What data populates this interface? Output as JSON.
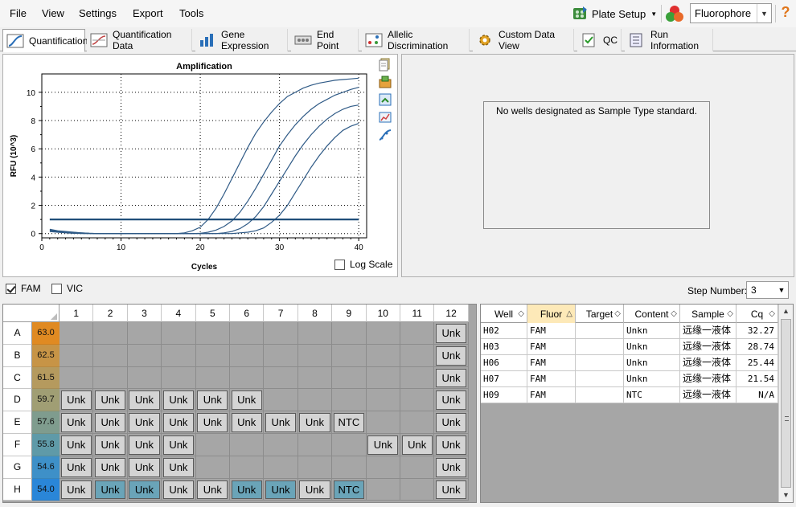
{
  "menu": {
    "file": "File",
    "view": "View",
    "settings": "Settings",
    "export": "Export",
    "tools": "Tools"
  },
  "toolbar": {
    "plate_setup": "Plate Setup",
    "fluorophore": "Fluorophore",
    "help": "?"
  },
  "tabs": [
    {
      "label": "Quantification",
      "icon": "amplification-chart-icon",
      "active": true
    },
    {
      "label": "Quantification Data",
      "icon": "data-chart-icon"
    },
    {
      "label": "Gene Expression",
      "icon": "bar-chart-icon"
    },
    {
      "label": "End Point",
      "icon": "endpoint-icon"
    },
    {
      "label": "Allelic Discrimination",
      "icon": "scatter-icon"
    },
    {
      "label": "Custom Data View",
      "icon": "gear-icon"
    },
    {
      "label": "QC",
      "icon": "qc-check-icon"
    },
    {
      "label": "Run Information",
      "icon": "run-info-icon"
    }
  ],
  "chart_data": {
    "type": "line",
    "title": "Amplification",
    "xlabel": "Cycles",
    "ylabel": "RFU (10^3)",
    "xlim": [
      0,
      41
    ],
    "ylim": [
      -0.3,
      11.3
    ],
    "x_ticks": [
      0,
      10,
      20,
      30,
      40
    ],
    "y_ticks": [
      0,
      2,
      4,
      6,
      8,
      10
    ],
    "grid": true,
    "threshold": 1.0,
    "x": [
      1,
      2,
      3,
      4,
      5,
      6,
      7,
      8,
      9,
      10,
      11,
      12,
      13,
      14,
      15,
      16,
      17,
      18,
      19,
      20,
      21,
      22,
      23,
      24,
      25,
      26,
      27,
      28,
      29,
      30,
      31,
      32,
      33,
      34,
      35,
      36,
      37,
      38,
      39,
      40
    ],
    "series": [
      {
        "well": "H07",
        "values": [
          0.3,
          0.2,
          0.15,
          0.1,
          0.05,
          0.02,
          0,
          0,
          0,
          0,
          0,
          0,
          0,
          0,
          0,
          0,
          0,
          0.05,
          0.2,
          0.45,
          1.0,
          1.8,
          2.8,
          3.9,
          5.0,
          6.1,
          7.1,
          7.9,
          8.6,
          9.2,
          9.7,
          10.0,
          10.3,
          10.5,
          10.65,
          10.75,
          10.85,
          10.9,
          10.95,
          11.0
        ]
      },
      {
        "well": "H06",
        "values": [
          0.25,
          0.18,
          0.12,
          0.08,
          0.05,
          0.02,
          0,
          0,
          0,
          0,
          0,
          0,
          0,
          0,
          0,
          0,
          0,
          0,
          0,
          0.02,
          0.1,
          0.25,
          0.5,
          0.9,
          1.5,
          2.3,
          3.2,
          4.2,
          5.2,
          6.2,
          7.0,
          7.7,
          8.3,
          8.8,
          9.2,
          9.5,
          9.8,
          10.0,
          10.2,
          10.35
        ]
      },
      {
        "well": "H03",
        "values": [
          0.2,
          0.15,
          0.1,
          0.05,
          0.02,
          0,
          0,
          0,
          0,
          0,
          0,
          0,
          0,
          0,
          0,
          0,
          0,
          0,
          0,
          0,
          0,
          0,
          0.05,
          0.15,
          0.35,
          0.7,
          1.2,
          1.9,
          2.8,
          3.7,
          4.6,
          5.5,
          6.3,
          7.0,
          7.6,
          8.1,
          8.5,
          8.8,
          9.0,
          9.1
        ]
      },
      {
        "well": "H02",
        "values": [
          0.15,
          0.1,
          0.05,
          0.02,
          0,
          0,
          0,
          0,
          0,
          0,
          0,
          0,
          0,
          0,
          0,
          0,
          0,
          0,
          0,
          0,
          0,
          0,
          0,
          0,
          0.05,
          0.1,
          0.2,
          0.4,
          0.8,
          1.3,
          2.0,
          2.9,
          3.8,
          4.7,
          5.5,
          6.2,
          6.8,
          7.3,
          7.6,
          7.8
        ]
      }
    ]
  },
  "log_scale_label": "Log Scale",
  "std_message": "No wells designated as Sample Type standard.",
  "filters": {
    "fam": "FAM",
    "vic": "VIC",
    "fam_checked": true,
    "vic_checked": false
  },
  "step": {
    "label": "Step Number:",
    "value": "3"
  },
  "plate": {
    "columns": [
      "1",
      "2",
      "3",
      "4",
      "5",
      "6",
      "7",
      "8",
      "9",
      "10",
      "11",
      "12"
    ],
    "rows": [
      {
        "label": "A",
        "temp": "63.0",
        "color": "#e08a22",
        "wells": [
          "",
          "",
          "",
          "",
          "",
          "",
          "",
          "",
          "",
          "",
          "",
          "Unk"
        ]
      },
      {
        "label": "B",
        "temp": "62.5",
        "color": "#c79446",
        "wells": [
          "",
          "",
          "",
          "",
          "",
          "",
          "",
          "",
          "",
          "",
          "",
          "Unk"
        ]
      },
      {
        "label": "C",
        "temp": "61.5",
        "color": "#b59a5e",
        "wells": [
          "",
          "",
          "",
          "",
          "",
          "",
          "",
          "",
          "",
          "",
          "",
          "Unk"
        ]
      },
      {
        "label": "D",
        "temp": "59.7",
        "color": "#a09e74",
        "wells": [
          "Unk",
          "Unk",
          "Unk",
          "Unk",
          "Unk",
          "Unk",
          "",
          "",
          "",
          "",
          "",
          "Unk"
        ]
      },
      {
        "label": "E",
        "temp": "57.6",
        "color": "#7f9c8e",
        "wells": [
          "Unk",
          "Unk",
          "Unk",
          "Unk",
          "Unk",
          "Unk",
          "Unk",
          "Unk",
          "NTC",
          "",
          "",
          "Unk"
        ]
      },
      {
        "label": "F",
        "temp": "55.8",
        "color": "#5f9aa8",
        "wells": [
          "Unk",
          "Unk",
          "Unk",
          "Unk",
          "",
          "",
          "",
          "",
          "",
          "Unk",
          "Unk",
          "Unk"
        ]
      },
      {
        "label": "G",
        "temp": "54.6",
        "color": "#3e90c8",
        "wells": [
          "Unk",
          "Unk",
          "Unk",
          "Unk",
          "",
          "",
          "",
          "",
          "",
          "",
          "",
          "Unk"
        ]
      },
      {
        "label": "H",
        "temp": "54.0",
        "color": "#2a86d8",
        "wells": [
          "Unk",
          "Unk",
          "Unk",
          "Unk",
          "Unk",
          "Unk",
          "Unk",
          "Unk",
          "NTC",
          "",
          "",
          "Unk"
        ],
        "selected": [
          1,
          2,
          5,
          6,
          8
        ]
      }
    ]
  },
  "table": {
    "headers": [
      "Well",
      "Fluor",
      "Target",
      "Content",
      "Sample",
      "Cq"
    ],
    "sorted_col": 1,
    "rows": [
      [
        "H02",
        "FAM",
        "",
        "Unkn",
        "远缘一液体",
        "32.27"
      ],
      [
        "H03",
        "FAM",
        "",
        "Unkn",
        "远缘一液体",
        "28.74"
      ],
      [
        "H06",
        "FAM",
        "",
        "Unkn",
        "远缘一液体",
        "25.44"
      ],
      [
        "H07",
        "FAM",
        "",
        "Unkn",
        "远缘一液体",
        "21.54"
      ],
      [
        "H09",
        "FAM",
        "",
        "NTC",
        "远缘一液体",
        "N/A"
      ]
    ]
  },
  "colors": {
    "curve": "#2f5a86",
    "threshold": "#1f4e79",
    "selected_well": "#6aa4b8",
    "well": "#d4d4d4"
  }
}
